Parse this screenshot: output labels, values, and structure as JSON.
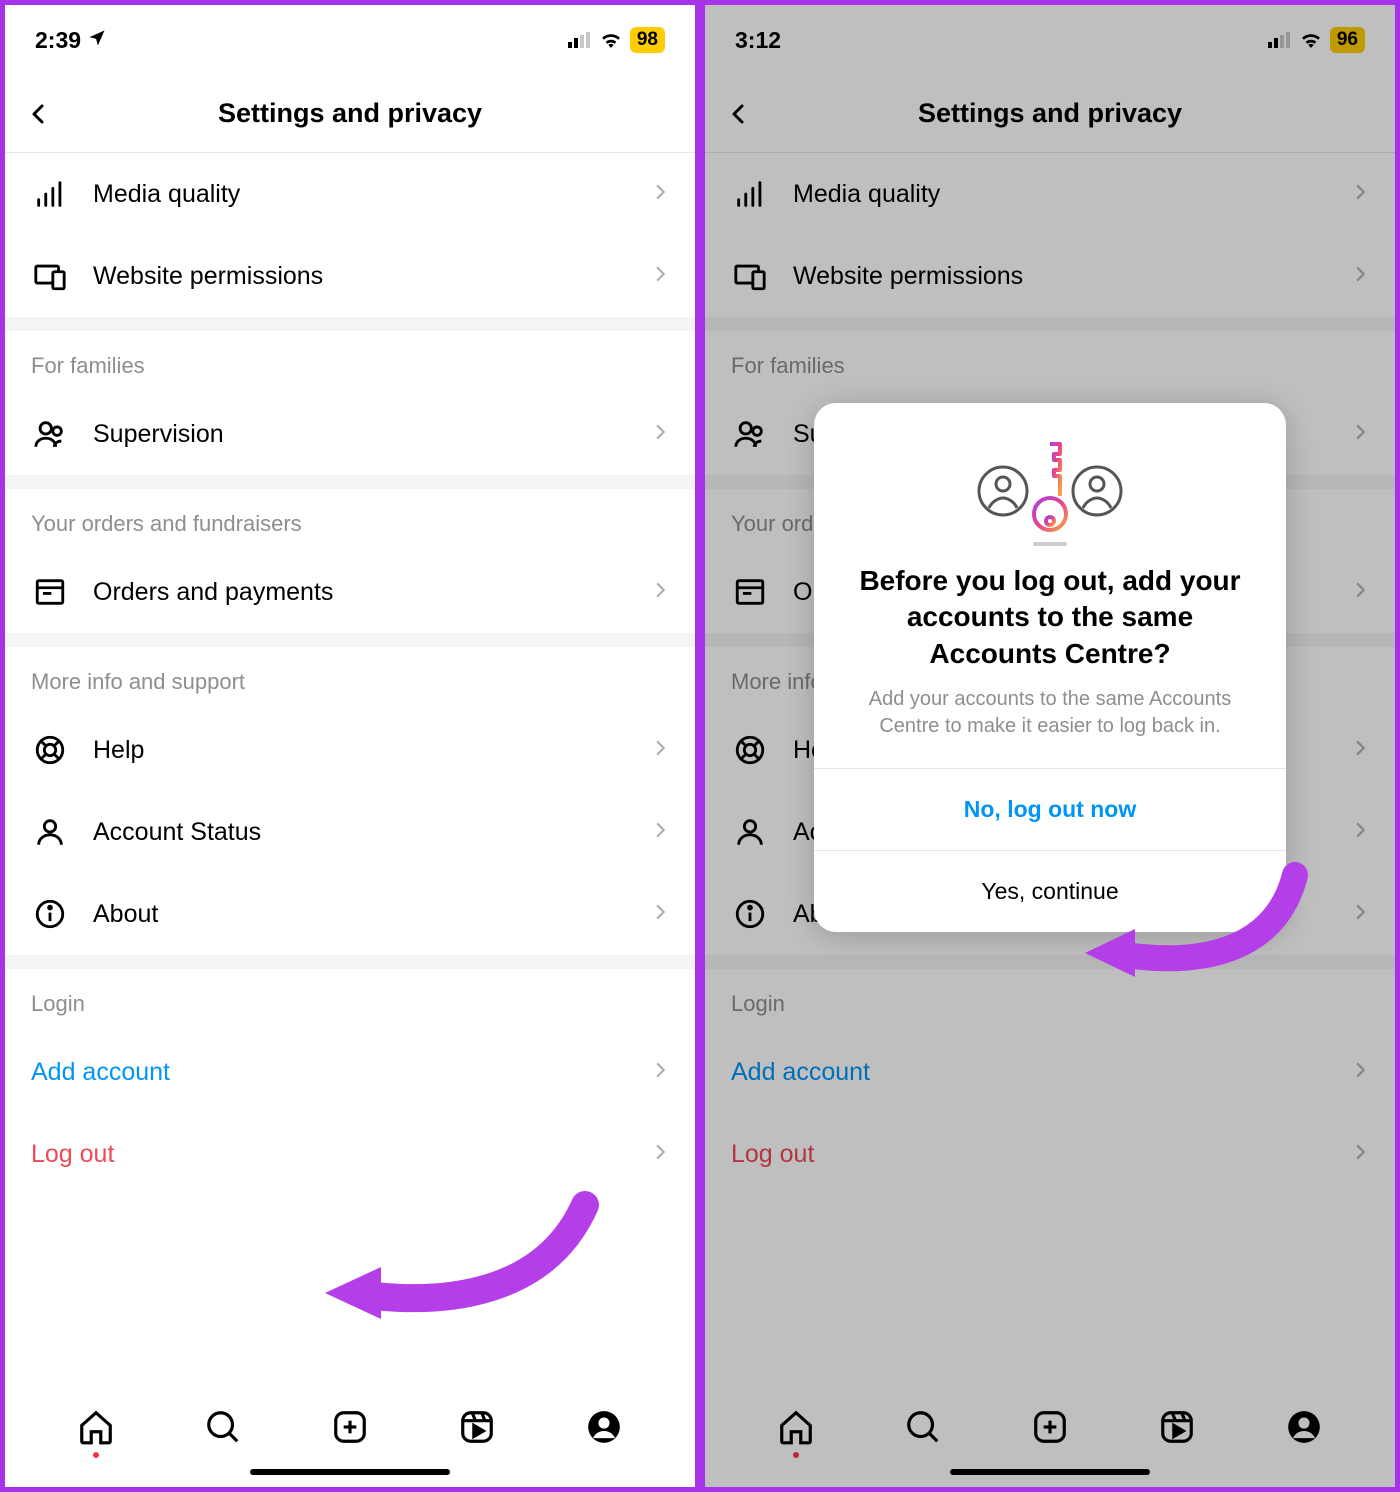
{
  "left": {
    "status": {
      "time": "2:39",
      "battery": "98"
    },
    "header": {
      "title": "Settings and privacy"
    },
    "items": {
      "media_quality": "Media quality",
      "website_permissions": "Website permissions"
    },
    "sections": {
      "families": {
        "header": "For families",
        "supervision": "Supervision"
      },
      "orders": {
        "header": "Your orders and fundraisers",
        "orders_payments": "Orders and payments"
      },
      "moreinfo": {
        "header": "More info and support",
        "help": "Help",
        "account_status": "Account Status",
        "about": "About"
      },
      "login": {
        "header": "Login",
        "add_account": "Add account",
        "log_out": "Log out"
      }
    }
  },
  "right": {
    "status": {
      "time": "3:12",
      "battery": "96"
    },
    "header": {
      "title": "Settings and privacy"
    },
    "items": {
      "media_quality": "Media quality",
      "website_permissions": "Website permissions"
    },
    "sections": {
      "families": {
        "header": "For families",
        "supervision": "Supervision"
      },
      "orders": {
        "header": "Your orders and fundraisers",
        "orders_payments": "Orders and payments"
      },
      "moreinfo": {
        "header": "More info and support",
        "help": "Help",
        "account_status": "Account Status",
        "about": "About"
      },
      "login": {
        "header": "Login",
        "add_account": "Add account",
        "log_out": "Log out"
      }
    },
    "modal": {
      "title": "Before you log out, add your accounts to the same Accounts Centre?",
      "desc": "Add your accounts to the same Accounts Centre to make it easier to log back in.",
      "primary": "No, log out now",
      "secondary": "Yes, continue"
    }
  }
}
